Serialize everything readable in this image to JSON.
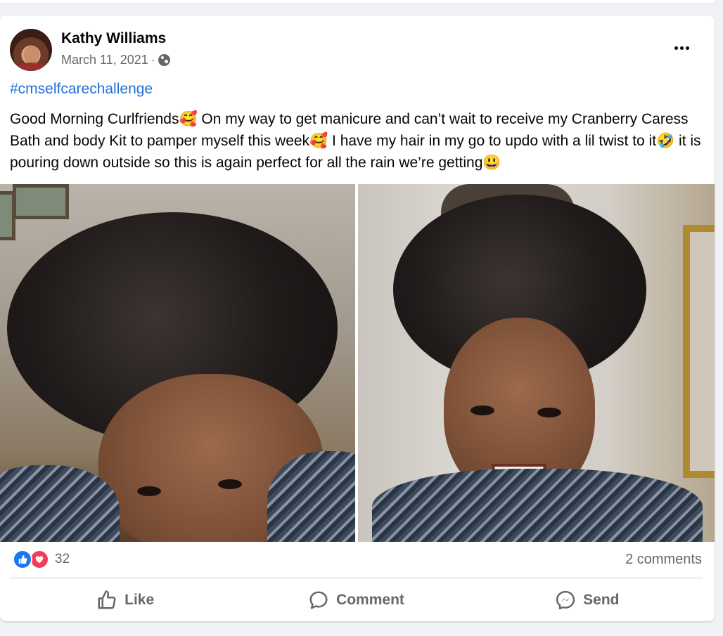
{
  "post": {
    "author": "Kathy Williams",
    "date": "March 11, 2021",
    "separator": "·",
    "audience_icon": "globe-icon",
    "more_icon": "more-options-icon",
    "hashtag": "#cmselfcarechallenge",
    "text": "Good Morning Curlfriends🥰 On my way to get manicure and can’t wait to receive my Cranberry Caress Bath and body Kit to pamper myself this week🥰 I have my hair in my go to updo with a lil twist to it🤣 it is pouring down outside so this is again perfect for all the rain we’re getting😃",
    "photos_count_shown": 2
  },
  "stats": {
    "reactions_count": "32",
    "comments": "2 comments",
    "reaction_icons": [
      "like-icon",
      "love-icon"
    ]
  },
  "actions": {
    "like": "Like",
    "comment": "Comment",
    "send": "Send"
  },
  "colors": {
    "link": "#216fdb",
    "like_blue": "#1877f2",
    "love_red": "#f33e58",
    "secondary_text": "#65676b"
  }
}
